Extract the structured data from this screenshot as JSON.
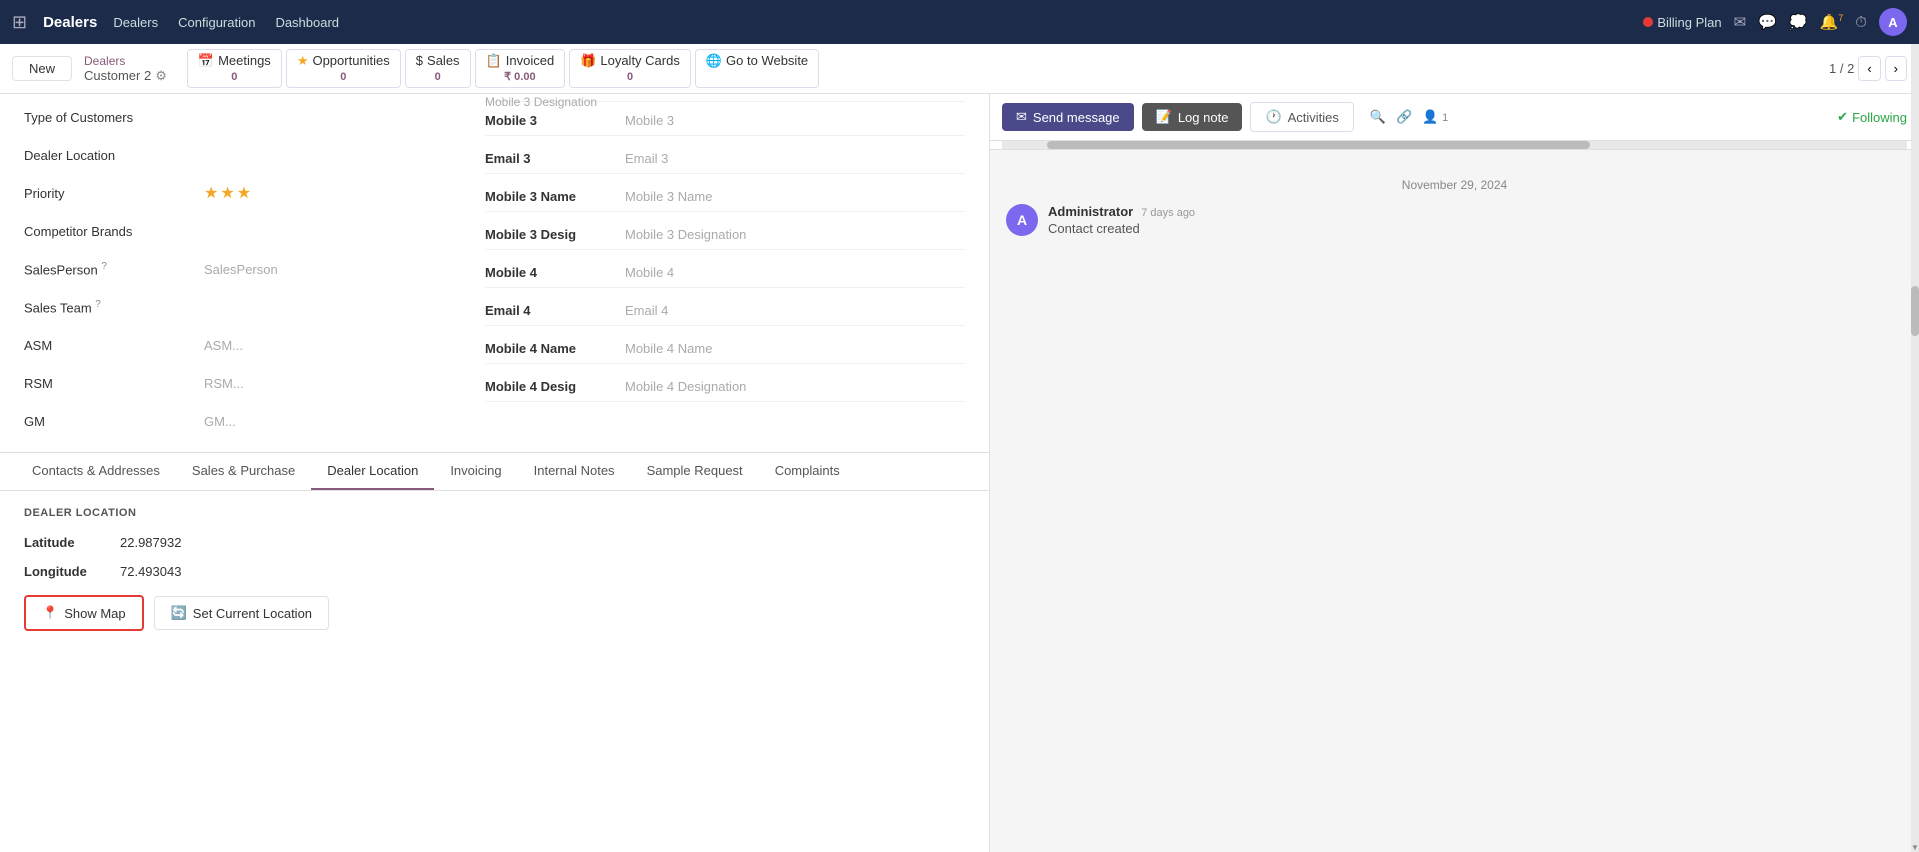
{
  "topnav": {
    "brand": "Dealers",
    "links": [
      "Dealers",
      "Configuration",
      "Dashboard"
    ],
    "billing_label": "Billing Plan",
    "notification_count": "7",
    "avatar_letter": "A"
  },
  "actionbar": {
    "new_label": "New",
    "breadcrumb_parent": "Dealers",
    "breadcrumb_current": "Customer 2",
    "stats": [
      {
        "icon": "📅",
        "label": "Meetings",
        "value": "0"
      },
      {
        "icon": "⭐",
        "label": "Opportunities",
        "value": "0"
      },
      {
        "icon": "$",
        "label": "Sales",
        "value": "0"
      },
      {
        "icon": "📋",
        "label": "Invoiced",
        "value": "₹ 0.00"
      },
      {
        "icon": "🎁",
        "label": "Loyalty Cards",
        "value": "0"
      },
      {
        "icon": "🌐",
        "label": "Go to Website",
        "value": ""
      }
    ],
    "pagination": "1 / 2"
  },
  "form": {
    "fields_left": [
      {
        "label": "Type of Customers",
        "value": ""
      },
      {
        "label": "Dealer Location",
        "value": ""
      },
      {
        "label": "Priority",
        "value": "stars"
      },
      {
        "label": "Competitor Brands",
        "value": ""
      },
      {
        "label": "SalesPerson",
        "value": "SalesPerson",
        "has_help": true
      },
      {
        "label": "Sales Team",
        "value": "",
        "has_help": true
      },
      {
        "label": "ASM",
        "value": "ASM..."
      },
      {
        "label": "RSM",
        "value": "RSM..."
      },
      {
        "label": "GM",
        "value": "GM..."
      }
    ],
    "fields_right": [
      {
        "label": "Mobile 3",
        "value": "Mobile 3"
      },
      {
        "label": "Email 3",
        "value": "Email 3"
      },
      {
        "label": "Mobile 3 Name",
        "value": "Mobile 3 Name"
      },
      {
        "label": "Mobile 3 Desig",
        "value": "Mobile 3 Designation"
      },
      {
        "label": "Mobile 4",
        "value": "Mobile 4"
      },
      {
        "label": "Email 4",
        "value": "Email 4"
      },
      {
        "label": "Mobile 4 Name",
        "value": "Mobile 4 Name"
      },
      {
        "label": "Mobile 4 Desig",
        "value": "Mobile 4 Designation"
      }
    ]
  },
  "tabs": [
    {
      "label": "Contacts & Addresses",
      "active": false
    },
    {
      "label": "Sales & Purchase",
      "active": false
    },
    {
      "label": "Dealer Location",
      "active": true
    },
    {
      "label": "Invoicing",
      "active": false
    },
    {
      "label": "Internal Notes",
      "active": false
    },
    {
      "label": "Sample Request",
      "active": false
    },
    {
      "label": "Complaints",
      "active": false
    }
  ],
  "dealer_location": {
    "section_title": "DEALER LOCATION",
    "latitude_label": "Latitude",
    "latitude_value": "22.987932",
    "longitude_label": "Longitude",
    "longitude_value": "72.493043",
    "show_map_label": "Show Map",
    "set_location_label": "Set Current Location"
  },
  "chatter": {
    "send_message_label": "Send message",
    "log_note_label": "Log note",
    "activities_label": "Activities",
    "following_label": "Following",
    "follower_count": "1",
    "date_divider": "November 29, 2024",
    "messages": [
      {
        "avatar": "A",
        "author": "Administrator",
        "time": "7 days ago",
        "text": "Contact created"
      }
    ]
  }
}
